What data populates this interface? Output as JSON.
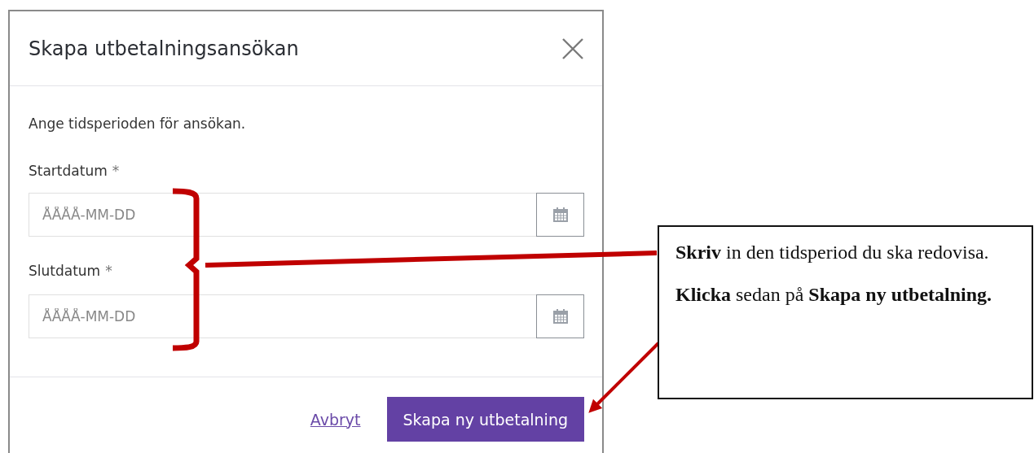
{
  "dialog": {
    "title": "Skapa utbetalningsansökan",
    "intro": "Ange tidsperioden för ansökan.",
    "fields": [
      {
        "label": "Startdatum",
        "required_mark": "*",
        "placeholder": "ÅÅÅÅ-MM-DD"
      },
      {
        "label": "Slutdatum",
        "required_mark": "*",
        "placeholder": "ÅÅÅÅ-MM-DD"
      }
    ],
    "cancel_link": "Avbryt",
    "submit_button": "Skapa ny utbetalning"
  },
  "callout": {
    "paragraphs": [
      "**Skriv** in den tidsperiod du ska redovisa.",
      "**Klicka** sedan på **Skapa ny utbetalning.**"
    ]
  }
}
